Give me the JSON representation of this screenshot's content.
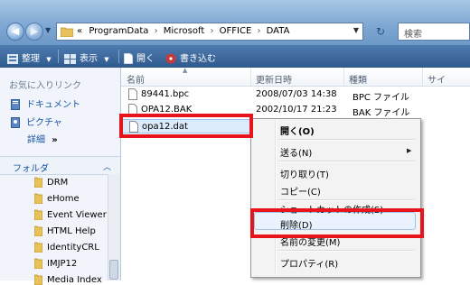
{
  "address_bar": {
    "path": [
      "ProgramData",
      "Microsoft",
      "OFFICE",
      "DATA"
    ],
    "overflow_glyph": "«",
    "search_placeholder": "検索"
  },
  "toolbar": {
    "organize": "整理",
    "views": "表示",
    "open": "開く",
    "burn": "書き込む"
  },
  "left_pane": {
    "favorites_header": "お気に入りリンク",
    "favorites": [
      "ドキュメント",
      "ピクチャ"
    ],
    "more": "詳細",
    "more_chevron": "»",
    "folders_header": "フォルダ",
    "folder_tree": [
      "DRM",
      "eHome",
      "Event Viewer",
      "HTML Help",
      "IdentityCRL",
      "IMJP12",
      "Media Index"
    ]
  },
  "file_list": {
    "columns": [
      "名前",
      "更新日時",
      "種類",
      "サイ"
    ],
    "rows": [
      {
        "name": "89441.bpc",
        "date": "2008/07/03 14:38",
        "type": "BPC ファイル"
      },
      {
        "name": "OPA12.BAK",
        "date": "2002/10/17 21:23",
        "type": "BAK ファイル"
      },
      {
        "name": "opa12.dat",
        "date": "",
        "type": ""
      }
    ]
  },
  "context_menu": {
    "items": [
      "開く(O)",
      "送る(N)",
      "切り取り(T)",
      "コピー(C)",
      "ショートカットの作成(S)",
      "削除(D)",
      "名前の変更(M)",
      "プロパティ(R)"
    ]
  },
  "colors": {
    "highlight_red": "#e8141b",
    "link_blue": "#1a55a5",
    "toolbar_blue": "#2f5a8e",
    "selection": "#dcebfb"
  }
}
